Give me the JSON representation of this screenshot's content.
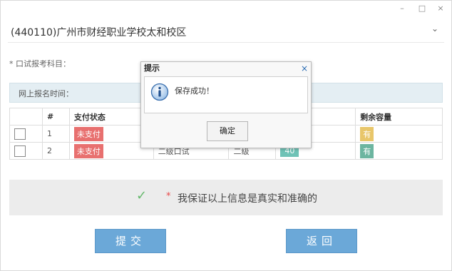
{
  "window": {
    "minimize": "–",
    "maximize": "□",
    "close": "×"
  },
  "school": {
    "name": "(440110)广州市财经职业学校太和校区",
    "chevron": "⌄"
  },
  "form": {
    "subject_label": "* 口试报考科目：",
    "reg_time_label": "网上报名时间："
  },
  "table": {
    "headers": [
      "",
      "#",
      "支付状态",
      "",
      "",
      "",
      "剩余容量"
    ],
    "rows": [
      {
        "num": "1",
        "status": "未支付",
        "col4": "",
        "col5": "",
        "col6": "",
        "capacity": "有"
      },
      {
        "num": "2",
        "status": "未支付",
        "col4": "二级口试",
        "col5": "二级",
        "col6": "40",
        "capacity": "有"
      }
    ]
  },
  "guarantee": {
    "star": "*",
    "text": "我保证以上信息是真实和准确的"
  },
  "buttons": {
    "submit": "提交",
    "back": "返回"
  },
  "dialog": {
    "title": "提示",
    "close": "×",
    "message": "保存成功！",
    "ok": "确定"
  },
  "colors": {
    "unpaid_badge": "#e8706f",
    "capacity_yellow": "#e8c66a",
    "capacity_green": "#6cb5a0",
    "button_blue": "#6ba8d8"
  }
}
